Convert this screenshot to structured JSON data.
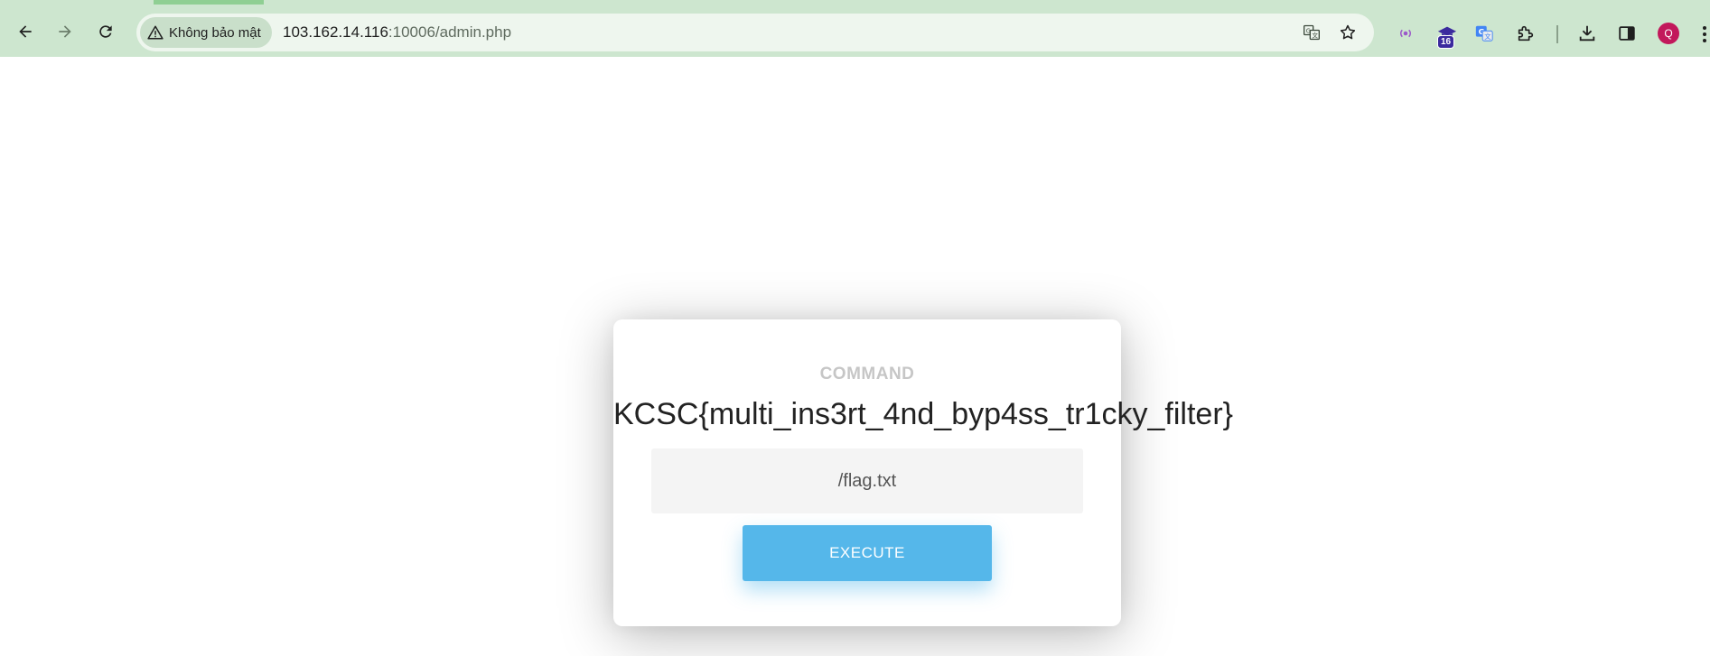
{
  "browser": {
    "security_label": "Không bảo mật",
    "url_host": "103.162.14.116",
    "url_rest": ":10006/admin.php",
    "extension_badge": "16",
    "profile_initial": "Q"
  },
  "page": {
    "heading": "COMMAND",
    "result": "KCSC{multi_ins3rt_4nd_byp4ss_tr1cky_filter}",
    "command_value": "/flag.txt",
    "execute_label": "EXECUTE"
  },
  "colors": {
    "chrome": "#cde6cf",
    "button": "#55b7ea",
    "avatar": "#c2185b"
  }
}
